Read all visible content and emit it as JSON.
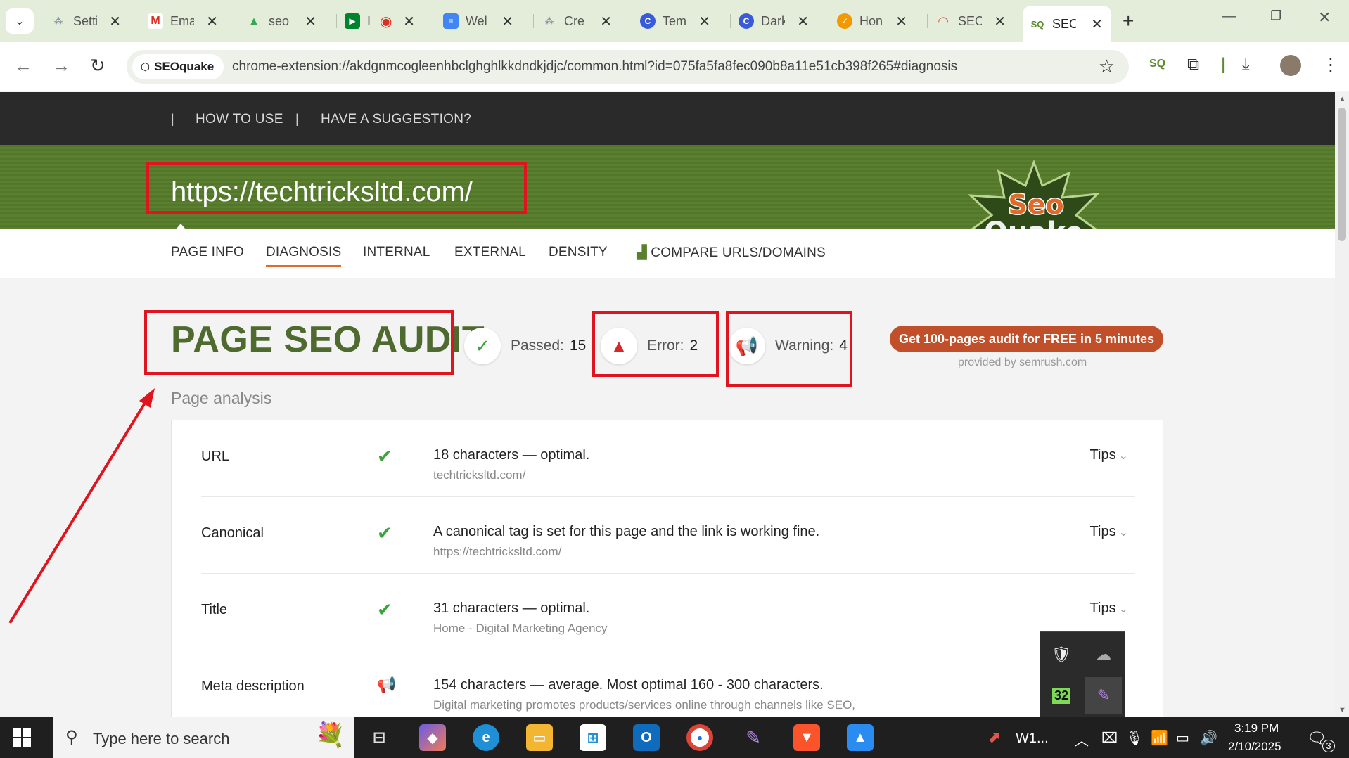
{
  "browser": {
    "tabs": [
      {
        "label": "Setti",
        "icon": "network-icon",
        "color": "#7d8a9a"
      },
      {
        "label": "Ema",
        "icon": "gmail-icon",
        "color": "#d93025"
      },
      {
        "label": "seo",
        "icon": "drive-icon",
        "color": "#34a853"
      },
      {
        "label": "I",
        "icon": "meet-icon",
        "color": "#00832d"
      },
      {
        "label": "Wel",
        "icon": "docs-icon",
        "color": "#4285f4"
      },
      {
        "label": "Cre",
        "icon": "network-icon",
        "color": "#7d8a9a"
      },
      {
        "label": "Tem",
        "icon": "canva-icon",
        "color": "#3a5bd9"
      },
      {
        "label": "Dark",
        "icon": "canva-icon",
        "color": "#3a5bd9"
      },
      {
        "label": "Hon",
        "icon": "check-icon",
        "color": "#f29900"
      },
      {
        "label": "SEO",
        "icon": "seo-rainbow-icon",
        "color": "#e0564a"
      },
      {
        "label": "SEO",
        "icon": "seoquake-icon",
        "color": "#5a8a2a"
      }
    ],
    "active_tab_index": 10,
    "site_chip": "SEOquake",
    "url": "chrome-extension://akdgnmcogleenhbclghghlkkdndkjdjc/common.html?id=075fa5fa8fec090b8a11e51cb398f265#diagnosis"
  },
  "seoquake": {
    "nav": {
      "how_to_use": "HOW TO USE",
      "suggestion": "HAVE A SUGGESTION?",
      "sep": "|"
    },
    "site_url": "https://techtricksltd.com/",
    "logo_line1": "Seo",
    "logo_line2": "Quake",
    "tabs": [
      "PAGE INFO",
      "DIAGNOSIS",
      "INTERNAL",
      "EXTERNAL",
      "DENSITY",
      "COMPARE URLS/DOMAINS"
    ],
    "active_tab": "DIAGNOSIS",
    "audit_title": "PAGE SEO AUDIT",
    "passed_label": "Passed:",
    "passed_count": "15",
    "error_label": "Error:",
    "error_count": "2",
    "warning_label": "Warning:",
    "warning_count": "4",
    "cta_label": "Get 100-pages audit for FREE in 5 minutes",
    "provided_by": "provided by  semrush.com",
    "section_title": "Page analysis",
    "tips_label": "Tips",
    "rows": [
      {
        "label": "URL",
        "status": "passed",
        "main": "18 characters — optimal.",
        "sub": "techtricksltd.com/"
      },
      {
        "label": "Canonical",
        "status": "passed",
        "main": "A canonical tag is set for this page and the link is working fine.",
        "sub": "https://techtricksltd.com/"
      },
      {
        "label": "Title",
        "status": "passed",
        "main": "31 characters — optimal.",
        "sub": "Home - Digital Marketing Agency"
      },
      {
        "label": "Meta description",
        "status": "warning",
        "main": "154 characters — average. Most optimal 160 - 300 characters.",
        "sub": "Digital marketing promotes products/services online through channels like SEO,"
      }
    ]
  },
  "tray_flyout": {
    "badge": "32"
  },
  "taskbar": {
    "search_placeholder": "Type here to search",
    "pinned_label": "W1...",
    "time": "3:19 PM",
    "date": "2/10/2025",
    "notification_count": "3"
  },
  "colors": {
    "accent_green": "#5a7f2e",
    "title_green": "#4e6a2e",
    "cta": "#c1502a",
    "annotation_red": "#e0141e",
    "tab_underline": "#e06a2a"
  }
}
